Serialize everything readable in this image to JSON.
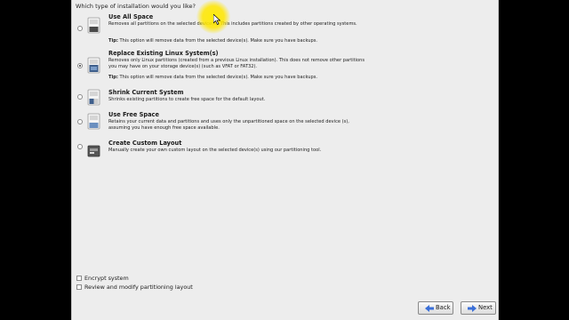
{
  "question": "Which type of installation would you like?",
  "options": [
    {
      "title": "Use All Space",
      "description": "Removes all partitions on the selected device(s).  This includes partitions created by other operating systems.",
      "tip_label": "Tip:",
      "tip": "This option will remove data from the selected device(s).  Make sure you have backups.",
      "selected": false
    },
    {
      "title": "Replace Existing Linux System(s)",
      "description": "Removes only Linux partitions (created from a previous Linux installation).  This does not remove other partitions you may have on your storage device(s) (such as VFAT or FAT32).",
      "tip_label": "Tip:",
      "tip": "This option will remove data from the selected device(s).  Make sure you have backups.",
      "selected": true
    },
    {
      "title": "Shrink Current System",
      "description": "Shrinks existing partitions to create free space for the default layout.",
      "selected": false
    },
    {
      "title": "Use Free Space",
      "description": "Retains your current data and partitions and uses only the unpartitioned space on the selected device (s), assuming you have enough free space available.",
      "selected": false
    },
    {
      "title": "Create Custom Layout",
      "description": "Manually create your own custom layout on the selected device(s) using our partitioning tool.",
      "selected": false
    }
  ],
  "checkboxes": [
    {
      "label": "Encrypt system",
      "checked": false
    },
    {
      "label": "Review and modify partitioning layout",
      "checked": false
    }
  ],
  "buttons": {
    "back": "Back",
    "next": "Next"
  },
  "icons": {
    "disk": "hard-disk-icon",
    "back": "back-arrow-icon",
    "next": "next-arrow-icon"
  },
  "colors": {
    "panel": "#ededed",
    "highlight_cursor": "#ffe600",
    "back_arrow": "#3a6fd8",
    "next_arrow": "#3a6fd8"
  }
}
